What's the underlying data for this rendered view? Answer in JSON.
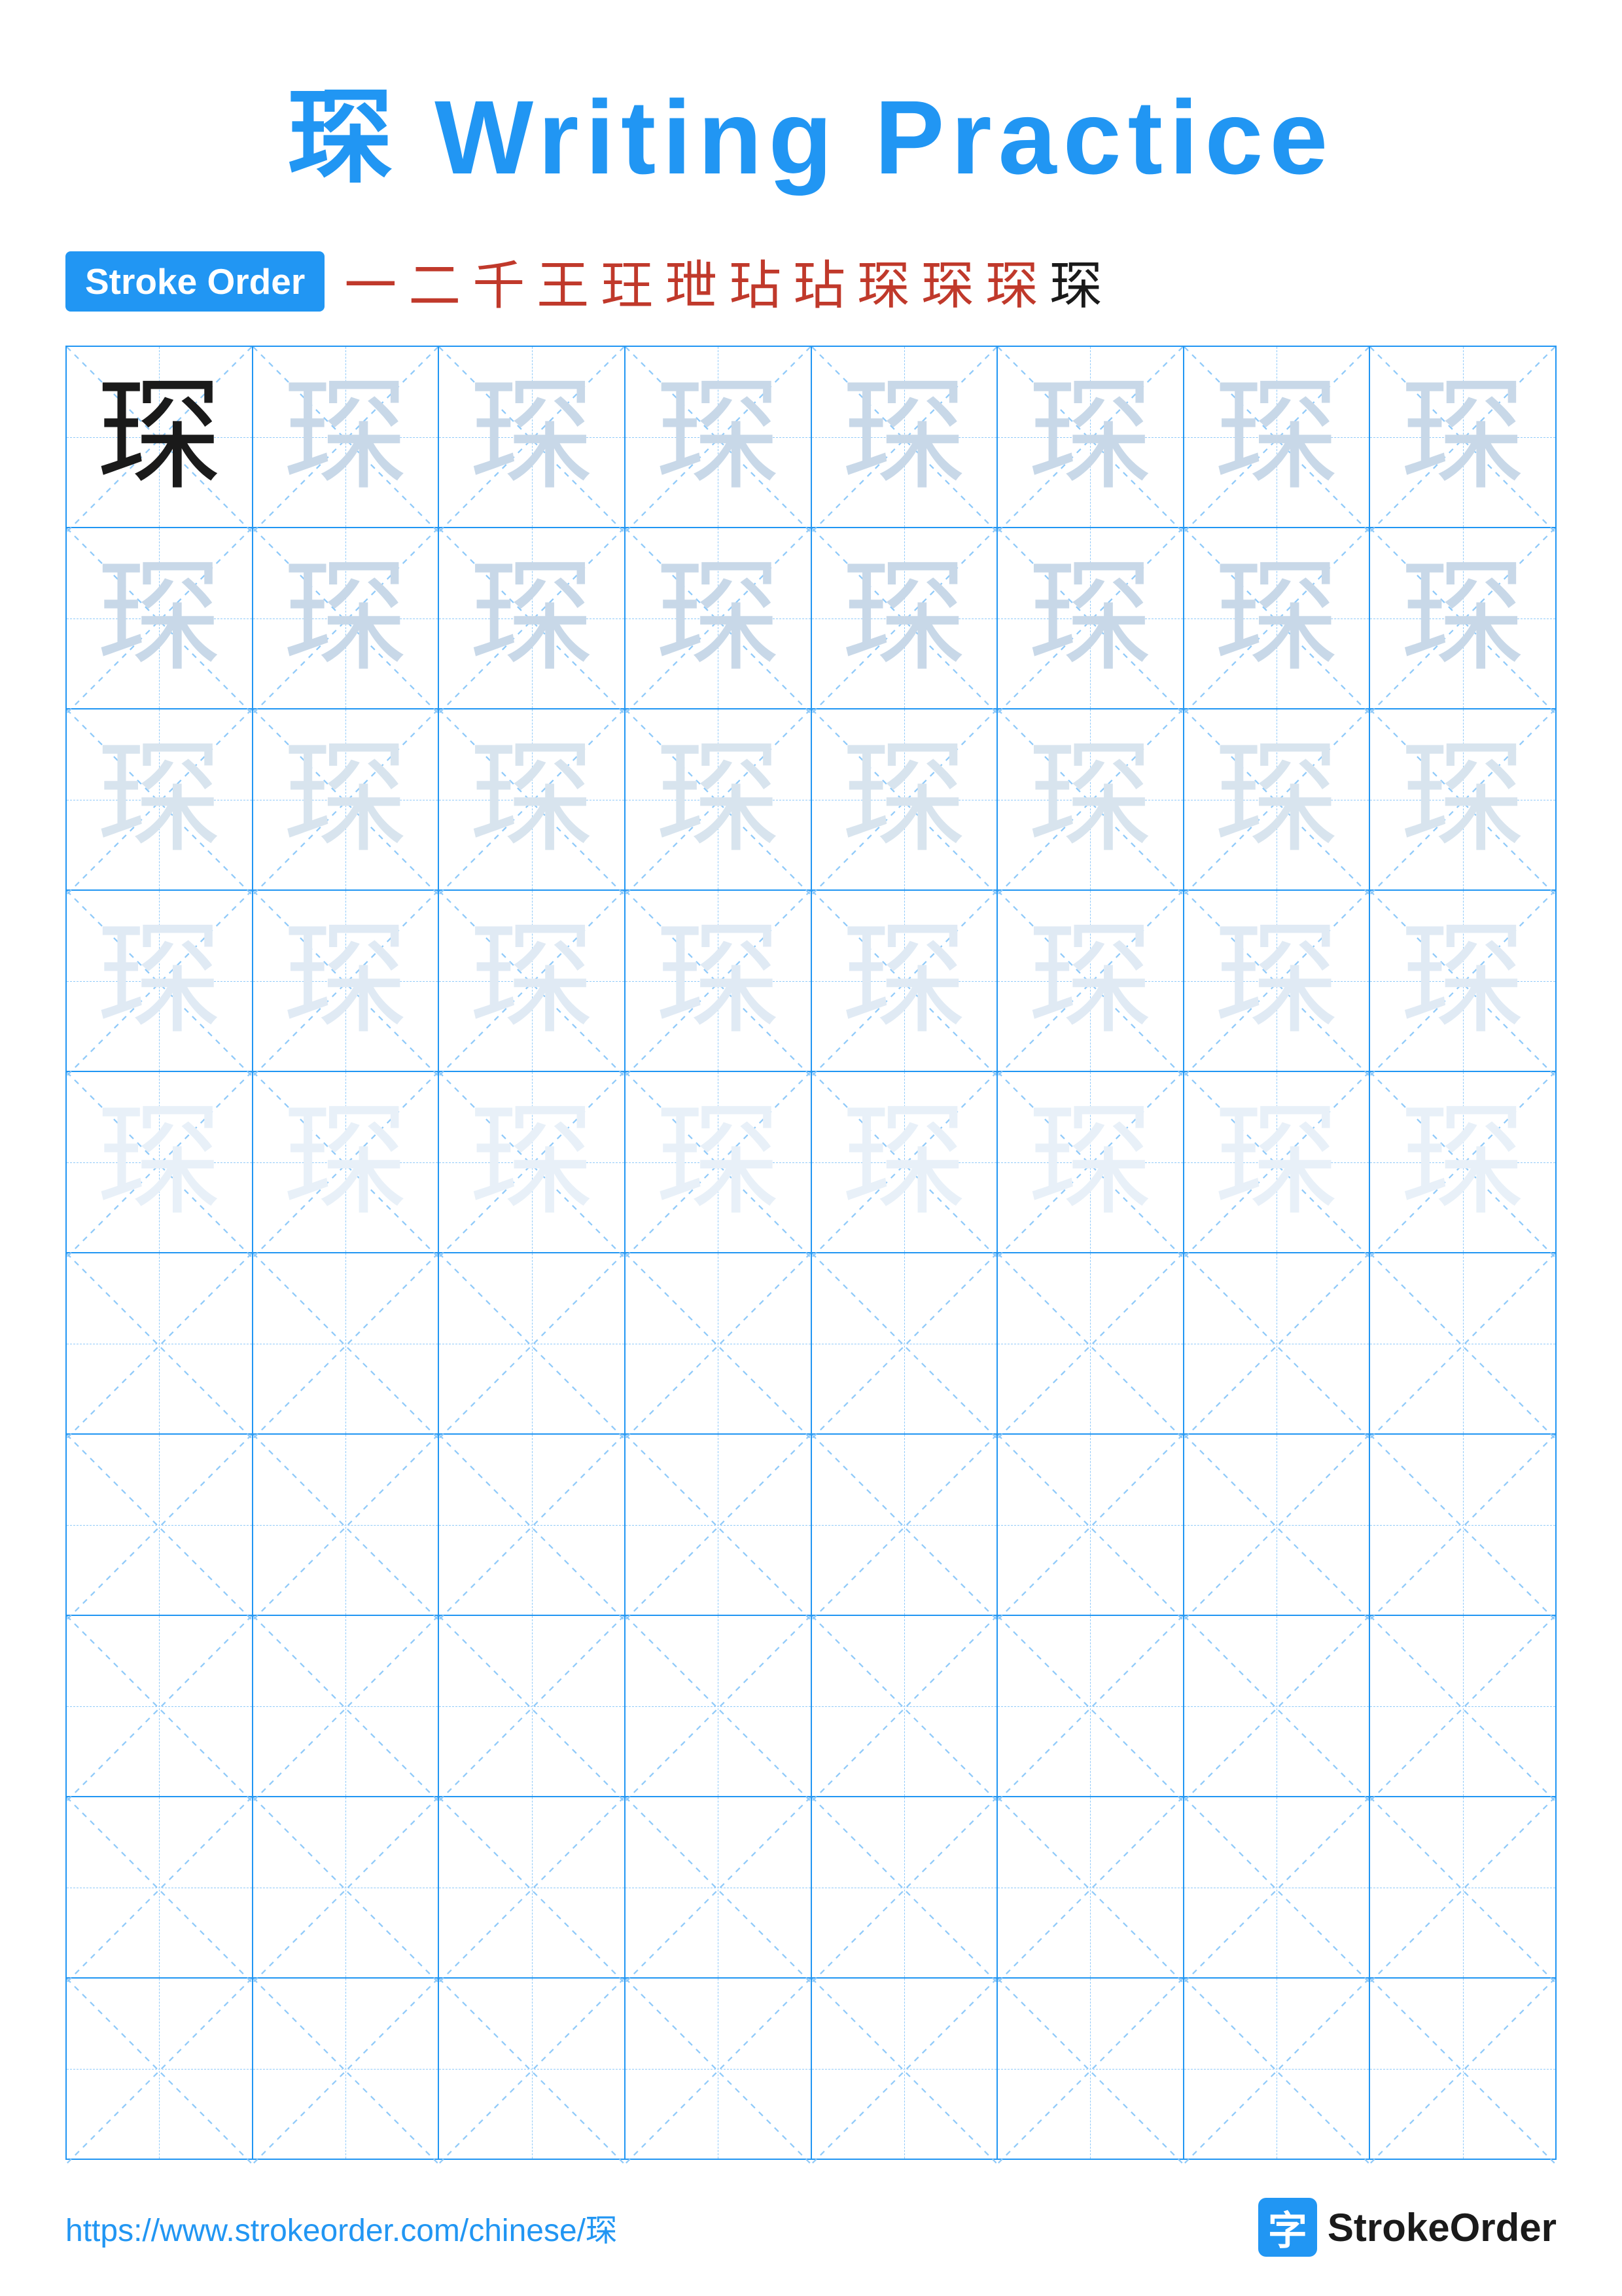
{
  "title": {
    "char": "琛",
    "suffix": " Writing Practice"
  },
  "stroke_order": {
    "badge_label": "Stroke Order",
    "steps": [
      "一",
      "二",
      "千",
      "王",
      "玨",
      "玴",
      "玷",
      "玷",
      "琛",
      "琛",
      "琛",
      "琛"
    ]
  },
  "grid": {
    "rows": 10,
    "cols": 8,
    "practice_char": "琛",
    "filled_rows": [
      {
        "opacity": "dark",
        "start": 0
      },
      {
        "opacity": "light1",
        "start": 0
      },
      {
        "opacity": "light2",
        "start": 0
      },
      {
        "opacity": "light3",
        "start": 0
      },
      {
        "opacity": "light4",
        "start": 0
      }
    ]
  },
  "footer": {
    "url": "https://www.strokeorder.com/chinese/琛",
    "logo_char": "字",
    "logo_text": "StrokeOrder"
  }
}
